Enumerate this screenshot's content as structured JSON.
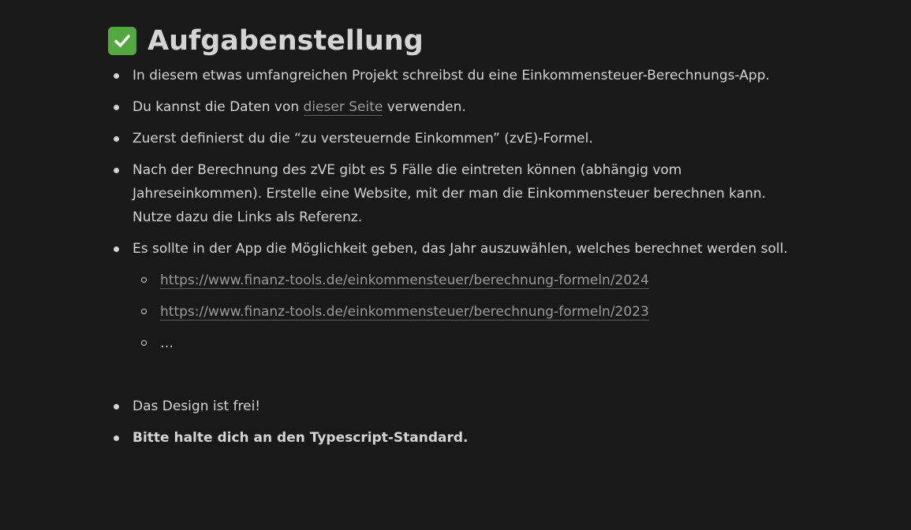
{
  "heading": {
    "icon": "check-mark-button-icon",
    "title": "Aufgabenstellung"
  },
  "items": [
    {
      "text": "In diesem etwas umfangreichen Projekt schreibst du eine Einkommensteuer-Berechnungs-App."
    },
    {
      "before": "Du kannst die Daten von ",
      "link": "dieser Seite",
      "after": " verwenden."
    },
    {
      "text": "Zuerst definierst du die “zu versteuernde Einkommen” (zvE)-Formel."
    },
    {
      "text": "Nach der Berechnung des zVE gibt es 5 Fälle die eintreten können (abhängig vom Jahreseinkommen). Erstelle eine Website, mit der man die Einkommensteuer berechnen kann. Nutze dazu die Links als Referenz."
    },
    {
      "text": "Es sollte in der App die Möglichkeit geben, das Jahr auszuwählen, welches berechnet werden soll."
    },
    {
      "text": "Das Design ist frei!"
    },
    {
      "text": "Bitte halte dich an den Typescript-Standard."
    }
  ],
  "sub_items": [
    {
      "link": "https://www.finanz-tools.de/einkommensteuer/berechnung-formeln/2024"
    },
    {
      "link": "https://www.finanz-tools.de/einkommensteuer/berechnung-formeln/2023"
    },
    {
      "text": "…"
    }
  ],
  "colors": {
    "background": "#191919",
    "text": "#d4d4d4",
    "link": "#9b9b9b",
    "check_icon": "#53a93f"
  }
}
